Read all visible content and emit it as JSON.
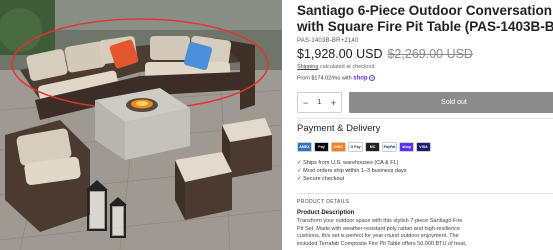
{
  "product": {
    "title_line1": "Santiago 6-Piece Outdoor Conversation Set",
    "title_line2": "with Square Fire Pit Table (PAS-1403B-BR+214",
    "sku": "PAS-1403B-BR+2140",
    "price": "$1,928.00 USD",
    "compare_price": "$2,269.00 USD",
    "shipping_text": "Shipping",
    "shipping_suffix": "calculated at checkout.",
    "installment_prefix": "From $174.02/mo with",
    "installment_brand": "shop",
    "info_glyph": "?"
  },
  "purchase": {
    "minus": "−",
    "quantity": "1",
    "plus": "+",
    "soldout_label": "Sold out"
  },
  "payment_delivery": {
    "heading": "Payment & Delivery",
    "methods": [
      {
        "name": "amex",
        "label": "AMEX",
        "color": "#2e77bc"
      },
      {
        "name": "apple-pay",
        "label": "Pay",
        "color": "#000000"
      },
      {
        "name": "discover",
        "label": "DISC",
        "color": "#f58220"
      },
      {
        "name": "google-pay",
        "label": "G Pay",
        "color": "#ffffff"
      },
      {
        "name": "mastercard",
        "label": "MC",
        "color": "#222222"
      },
      {
        "name": "paypal",
        "label": "PayPal",
        "color": "#ffffff"
      },
      {
        "name": "shop-pay",
        "label": "shop",
        "color": "#5a31f4"
      },
      {
        "name": "visa",
        "label": "VISA",
        "color": "#1a1f71"
      }
    ],
    "bullets": [
      "✓ Ships from U.S. warehouses (CA & FL)",
      "✓ Most orders ship within 1–3 business days",
      "✓ Secure checkout"
    ]
  },
  "details": {
    "section_label": "PRODUCT DETAILS",
    "desc_title": "Product Description",
    "desc_lines": [
      "Transform your outdoor space with this stylish 7-piece Santiago Fire",
      "Pit Set. Made with weather-resistant poly rattan and high-resilience",
      "cushions, this set is perfect for year-round outdoor enjoyment. The",
      "included Terrafab Composite Fire Pit Table offers 50,000 BTU of heat,"
    ]
  },
  "colors": {
    "accent_shop": "#5a31f4",
    "soldout_bg": "#8c8c8c",
    "annotation_red": "#e5322d"
  }
}
